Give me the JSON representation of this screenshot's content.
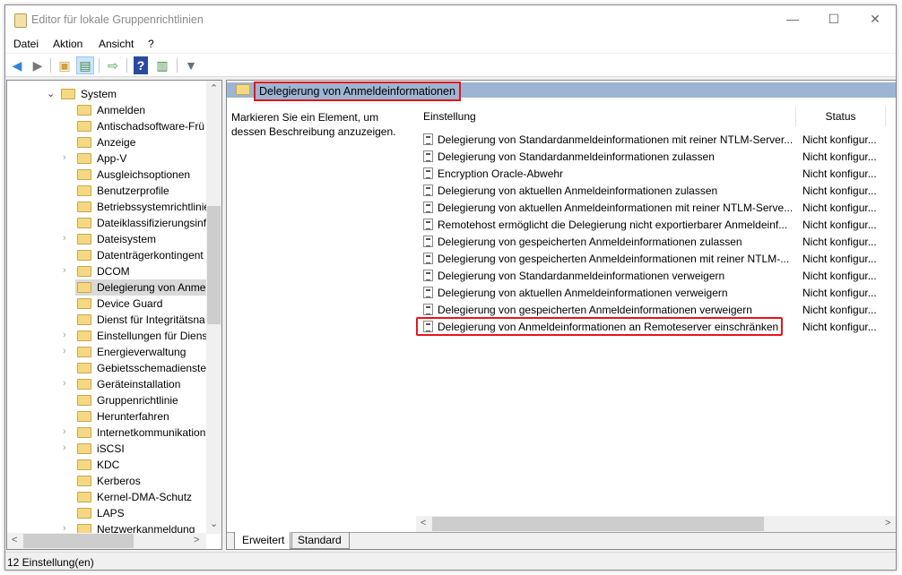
{
  "window": {
    "title": "Editor für lokale Gruppenrichtlinien",
    "minimize": "—",
    "maximize": "☐",
    "close": "✕"
  },
  "menu": [
    "Datei",
    "Aktion",
    "Ansicht",
    "?"
  ],
  "toolbar": [
    "back-icon",
    "forward-icon",
    "up-folder-icon",
    "show-hide-tree-icon",
    "export-list-icon",
    "help-icon",
    "show-hide-action-pane-icon",
    "filter-icon"
  ],
  "tree": {
    "items": [
      {
        "label": "System",
        "expanded": true,
        "level": 0
      },
      {
        "label": "Anmelden"
      },
      {
        "label": "Antischadsoftware-Frü"
      },
      {
        "label": "Anzeige"
      },
      {
        "label": "App-V",
        "expandable": true
      },
      {
        "label": "Ausgleichsoptionen"
      },
      {
        "label": "Benutzerprofile"
      },
      {
        "label": "Betriebssystemrichtlinie"
      },
      {
        "label": "Dateiklassifizierungsinf"
      },
      {
        "label": "Dateisystem",
        "expandable": true
      },
      {
        "label": "Datenträgerkontingent"
      },
      {
        "label": "DCOM",
        "expandable": true
      },
      {
        "label": "Delegierung von Anme",
        "selected": true
      },
      {
        "label": "Device Guard"
      },
      {
        "label": "Dienst für Integritätsna"
      },
      {
        "label": "Einstellungen für Diens",
        "expandable": true
      },
      {
        "label": "Energieverwaltung",
        "expandable": true
      },
      {
        "label": "Gebietsschemadienste"
      },
      {
        "label": "Geräteinstallation",
        "expandable": true
      },
      {
        "label": "Gruppenrichtlinie"
      },
      {
        "label": "Herunterfahren"
      },
      {
        "label": "Internetkommunikation",
        "expandable": true
      },
      {
        "label": "iSCSI",
        "expandable": true
      },
      {
        "label": "KDC"
      },
      {
        "label": "Kerberos"
      },
      {
        "label": "Kernel-DMA-Schutz"
      },
      {
        "label": "LAPS"
      },
      {
        "label": "Netzwerkanmeldung",
        "expandable": true
      }
    ]
  },
  "main": {
    "header": "Delegierung von Anmeldeinformationen",
    "description": "Markieren Sie ein Element, um dessen Beschreibung anzuzeigen.",
    "columns": [
      "Einstellung",
      "Status"
    ],
    "rows": [
      {
        "name": "Delegierung von Standardanmeldeinformationen mit reiner NTLM-Server...",
        "status": "Nicht konfigur..."
      },
      {
        "name": "Delegierung von Standardanmeldeinformationen zulassen",
        "status": "Nicht konfigur..."
      },
      {
        "name": "Encryption Oracle-Abwehr",
        "status": "Nicht konfigur..."
      },
      {
        "name": "Delegierung von aktuellen Anmeldeinformationen zulassen",
        "status": "Nicht konfigur..."
      },
      {
        "name": "Delegierung von aktuellen Anmeldeinformationen mit reiner NTLM-Serve...",
        "status": "Nicht konfigur..."
      },
      {
        "name": "Remotehost ermöglicht die Delegierung nicht exportierbarer Anmeldeinf...",
        "status": "Nicht konfigur..."
      },
      {
        "name": "Delegierung von gespeicherten Anmeldeinformationen zulassen",
        "status": "Nicht konfigur..."
      },
      {
        "name": "Delegierung von gespeicherten Anmeldeinformationen mit reiner NTLM-...",
        "status": "Nicht konfigur..."
      },
      {
        "name": "Delegierung von Standardanmeldeinformationen verweigern",
        "status": "Nicht konfigur..."
      },
      {
        "name": "Delegierung von aktuellen Anmeldeinformationen verweigern",
        "status": "Nicht konfigur..."
      },
      {
        "name": "Delegierung von gespeicherten Anmeldeinformationen verweigern",
        "status": "Nicht konfigur..."
      },
      {
        "name": "Delegierung von Anmeldeinformationen an Remoteserver einschränken",
        "status": "Nicht konfigur...",
        "highlighted": true
      }
    ],
    "tabs": [
      "Erweitert",
      "Standard"
    ],
    "active_tab": "Erweitert"
  },
  "status_bar": "12 Einstellung(en)",
  "colors": {
    "highlight": "#e8141b",
    "header_band": "#9db4d2"
  }
}
